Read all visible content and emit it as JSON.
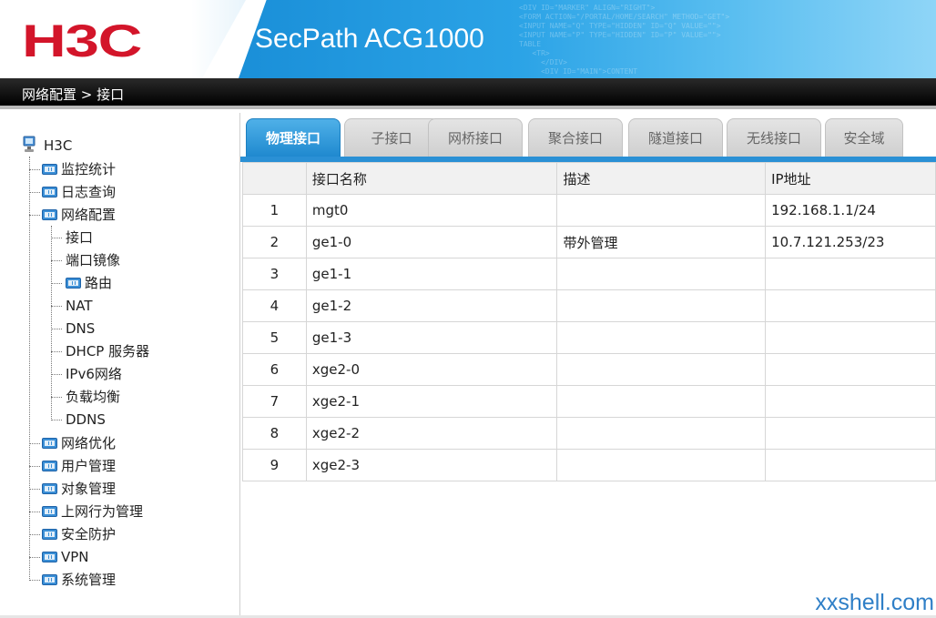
{
  "header": {
    "logo": "H3C",
    "product": "SecPath ACG1000",
    "code_text": "<DIV ID=\"MARKER\" ALIGN=\"RIGHT\">\n<FORM ACTION=\"/PORTAL/HOME/SEARCH\" METHOD=\"GET\">\n<INPUT NAME=\"Q\" TYPE=\"HIDDEN\" ID=\"Q\" VALUE=\"\">\n<INPUT NAME=\"P\" TYPE=\"HIDDEN\" ID=\"P\" VALUE=\"\">\nTABLE\n   <TR>\n     </DIV>\n     <DIV ID=\"MAIN\">CONTENT\n        <!-- MAIN CONTENT -->"
  },
  "breadcrumb": "网络配置 > 接口",
  "sidebar": {
    "root": "H3C",
    "items": [
      {
        "label": "监控统计"
      },
      {
        "label": "日志查询"
      },
      {
        "label": "网络配置"
      },
      {
        "label": "接口"
      },
      {
        "label": "端口镜像"
      },
      {
        "label": "路由"
      },
      {
        "label": "NAT"
      },
      {
        "label": "DNS"
      },
      {
        "label": "DHCP 服务器"
      },
      {
        "label": "IPv6网络"
      },
      {
        "label": "负载均衡"
      },
      {
        "label": "DDNS"
      },
      {
        "label": "网络优化"
      },
      {
        "label": "用户管理"
      },
      {
        "label": "对象管理"
      },
      {
        "label": "上网行为管理"
      },
      {
        "label": "安全防护"
      },
      {
        "label": "VPN"
      },
      {
        "label": "系统管理"
      }
    ]
  },
  "tabs": [
    {
      "label": "物理接口"
    },
    {
      "label": "子接口"
    },
    {
      "label": "网桥接口"
    },
    {
      "label": "聚合接口"
    },
    {
      "label": "隧道接口"
    },
    {
      "label": "无线接口"
    },
    {
      "label": "安全域"
    }
  ],
  "table": {
    "headers": [
      "",
      "接口名称",
      "描述",
      "IP地址"
    ],
    "rows": [
      {
        "idx": "1",
        "name": "mgt0",
        "desc": "",
        "ip": "192.168.1.1/24"
      },
      {
        "idx": "2",
        "name": "ge1-0",
        "desc": "带外管理",
        "ip": "10.7.121.253/23"
      },
      {
        "idx": "3",
        "name": "ge1-1",
        "desc": "",
        "ip": ""
      },
      {
        "idx": "4",
        "name": "ge1-2",
        "desc": "",
        "ip": ""
      },
      {
        "idx": "5",
        "name": "ge1-3",
        "desc": "",
        "ip": ""
      },
      {
        "idx": "6",
        "name": "xge2-0",
        "desc": "",
        "ip": ""
      },
      {
        "idx": "7",
        "name": "xge2-1",
        "desc": "",
        "ip": ""
      },
      {
        "idx": "8",
        "name": "xge2-2",
        "desc": "",
        "ip": ""
      },
      {
        "idx": "9",
        "name": "xge2-3",
        "desc": "",
        "ip": ""
      }
    ]
  },
  "watermark": "xxshell.com",
  "colors": {
    "brand_red": "#d3152a",
    "accent_blue": "#2a90d5"
  }
}
